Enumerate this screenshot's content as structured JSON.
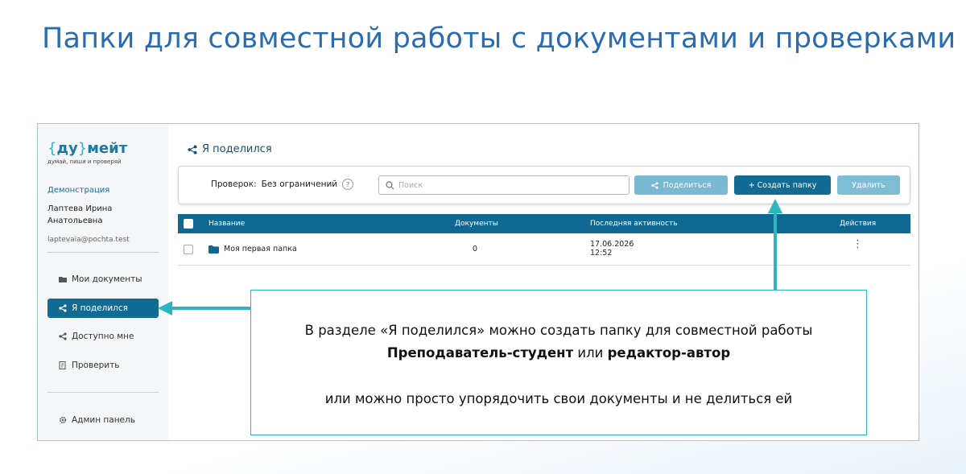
{
  "slide": {
    "title": "Папки для совместной работы с документами и проверками"
  },
  "sidebar": {
    "logo_brace_open": "{",
    "logo_du": "ду",
    "logo_brace_close": "}",
    "logo_meit": "мейт",
    "logo_tagline": "думай, пиши и проверяй",
    "demo_label": "Демонстрация",
    "user_name_line1": "Лаптева Ирина",
    "user_name_line2": "Анатольевна",
    "user_email": "laptevaia@pochta.test",
    "items": [
      {
        "label": "Мои документы",
        "icon": "folder-open-icon"
      },
      {
        "label": "Я поделился",
        "icon": "share-icon",
        "active": true
      },
      {
        "label": "Доступно мне",
        "icon": "share-icon"
      },
      {
        "label": "Проверить",
        "icon": "check-doc-icon"
      },
      {
        "label": "Админ панель",
        "icon": "gear-icon"
      }
    ]
  },
  "main": {
    "page_title": "Я поделился",
    "quota_label": "Проверок:",
    "quota_value": "Без ограничений",
    "help_glyph": "?",
    "search_placeholder": "Поиск",
    "share_button": "Поделиться",
    "create_button": "+ Создать папку",
    "delete_button": "Удалить",
    "table": {
      "columns": [
        "Название",
        "Документы",
        "Последняя активность",
        "Действия"
      ],
      "rows": [
        {
          "name": "Моя первая папка",
          "documents": "0",
          "date": "17.06.2026",
          "time": "12:52",
          "actions": "⋮"
        }
      ]
    }
  },
  "callout": {
    "line1": "В разделе «Я поделился» можно создать папку для совместной работы",
    "line2_bold1": "Преподаватель-студент",
    "line2_mid": " или ",
    "line2_bold2": "редактор-автор",
    "line3": "или можно просто упорядочить свои документы и не делиться ей"
  },
  "colors": {
    "accent": "#116b92",
    "title": "#2b6cb0",
    "callout_border": "#2ab5c0"
  }
}
